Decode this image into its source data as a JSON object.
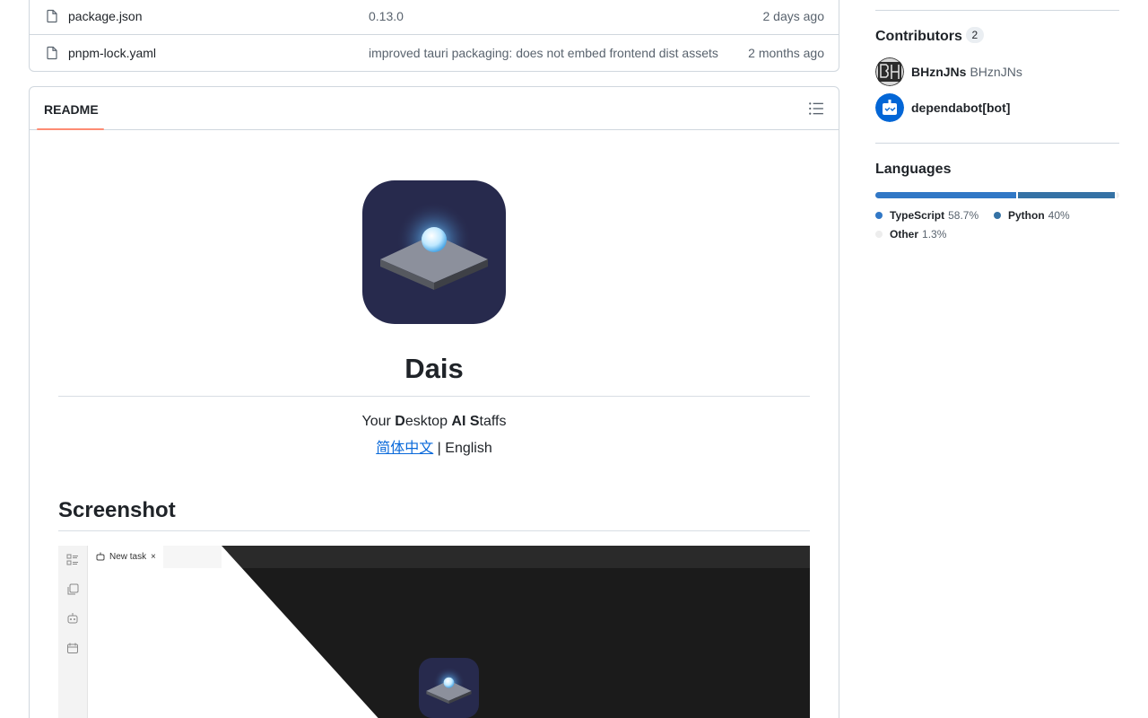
{
  "files": [
    {
      "name": "package.json",
      "message": "0.13.0",
      "date": "2 days ago"
    },
    {
      "name": "pnpm-lock.yaml",
      "message": "improved tauri packaging: does not embed frontend dist assets",
      "date": "2 months ago"
    }
  ],
  "readme": {
    "tab_label": "README",
    "title": "Dais",
    "tagline_parts": [
      "Your ",
      "D",
      "esktop ",
      "AI",
      " ",
      "S",
      "taffs"
    ],
    "lang_link": "简体中文",
    "lang_rest": " | English",
    "section_heading": "Screenshot",
    "shot": {
      "tab_label": "New task",
      "tab_close": "×"
    }
  },
  "sidebar": {
    "contributors": {
      "heading": "Contributors",
      "count": "2",
      "items": [
        {
          "login": "BHznJNs",
          "name": "BHznJNs",
          "avatar": "bhznjns-avatar"
        },
        {
          "login": "dependabot[bot]",
          "name": "",
          "avatar": "dependabot-avatar"
        }
      ]
    },
    "languages": {
      "heading": "Languages",
      "items": [
        {
          "name": "TypeScript",
          "percent": "58.7%",
          "value": 58.7,
          "color": "#3178c6"
        },
        {
          "name": "Python",
          "percent": "40%",
          "value": 40,
          "color": "#3572A5"
        },
        {
          "name": "Other",
          "percent": "1.3%",
          "value": 1.3,
          "color": "#ededed"
        }
      ]
    }
  },
  "colors": {
    "accent_link": "#0969da",
    "tab_underline": "#fd8c73",
    "border": "#d0d7de"
  }
}
